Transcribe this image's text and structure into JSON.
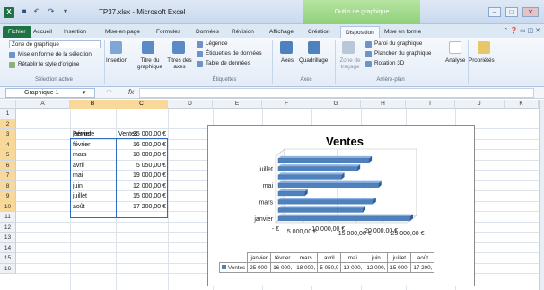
{
  "window": {
    "title": "TP37.xlsx - Microsoft Excel",
    "context_tab_group": "Outils de graphique"
  },
  "tabs": [
    "Fichier",
    "Accueil",
    "Insertion",
    "Mise en page",
    "Formules",
    "Données",
    "Révision",
    "Affichage",
    "Création",
    "Disposition",
    "Mise en forme"
  ],
  "active_tab": "Disposition",
  "ribbon": {
    "selection_dropdown": "Zone de graphique",
    "format_selection": "Mise en forme de la sélection",
    "reset_style": "Rétablir le style d'origine",
    "group_selection": "Sélection active",
    "insertion": "Insertion",
    "chart_title": "Titre du graphique",
    "axis_titles": "Titres des axes",
    "legend": "Légende",
    "data_labels": "Étiquettes de données",
    "data_table": "Table de données",
    "group_labels": "Étiquettes",
    "axes": "Axes",
    "gridlines": "Quadrillage",
    "group_axes": "Axes",
    "plot_area": "Zone de traçage",
    "chart_wall": "Paroi du graphique",
    "chart_floor": "Plancher du graphique",
    "rotation": "Rotation 3D",
    "group_background": "Arrière-plan",
    "analysis": "Analyse",
    "properties": "Propriétés"
  },
  "formula_bar": {
    "name_box": "Graphique 1",
    "fx": "fx",
    "formula": ""
  },
  "grid": {
    "columns": [
      "A",
      "B",
      "C",
      "D",
      "E",
      "F",
      "G",
      "H",
      "I",
      "J",
      "K"
    ],
    "rows": [
      "1",
      "2",
      "3",
      "4",
      "5",
      "6",
      "7",
      "8",
      "9",
      "10",
      "11",
      "12",
      "13",
      "14",
      "15",
      "16"
    ],
    "header_periode": "Période",
    "header_ventes": "Ventes",
    "periods": [
      "janvier",
      "février",
      "mars",
      "avril",
      "mai",
      "juin",
      "juillet",
      "août"
    ],
    "sales": [
      "25 000,00 €",
      "16 000,00 €",
      "18 000,00 €",
      "5 050,00 €",
      "19 000,00 €",
      "12 000,00 €",
      "15 000,00 €",
      "17 200,00 €"
    ]
  },
  "chart_data": {
    "type": "bar",
    "title": "Ventes",
    "categories": [
      "janvier",
      "février",
      "mars",
      "avril",
      "mai",
      "juin",
      "juillet",
      "août"
    ],
    "shown_category_labels": [
      "janvier",
      "mars",
      "mai",
      "juillet"
    ],
    "values": [
      25000,
      16000,
      18000,
      5050,
      19000,
      12000,
      15000,
      17200
    ],
    "x_tick_labels": [
      "- €",
      "5 000,00 €",
      "10 000,00 €",
      "15 000,00 €",
      "20 000,00 €",
      "25 000,00 €"
    ],
    "xlim": [
      0,
      25000
    ],
    "grid": true,
    "series_color": "#4f81bd",
    "data_table": {
      "series_label": "Ventes",
      "cells": [
        "25 000,",
        "16 000,",
        "18 000,",
        "5 050,0",
        "19 000,",
        "12 000,",
        "15 000,",
        "17 200,"
      ]
    }
  }
}
